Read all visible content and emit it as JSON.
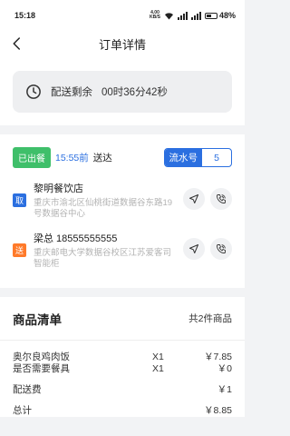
{
  "status_bar": {
    "time": "15:18",
    "net_speed_value": "4.00",
    "net_speed_unit": "KB/S",
    "battery": "48%"
  },
  "nav": {
    "title": "订单详情"
  },
  "countdown": {
    "label": "配送剩余",
    "value": "00时36分42秒"
  },
  "delivery": {
    "status_badge": "已出餐",
    "deadline_time": "15:55前",
    "deadline_suffix": "送达",
    "serial_label": "流水号",
    "serial_number": "5",
    "pickup": {
      "tag": "取",
      "name": "黎明餐饮店",
      "address": "重庆市渝北区仙桃街道数据谷东路19号数据谷中心"
    },
    "dropoff": {
      "tag": "送",
      "name": "梁总 18555555555",
      "address": "重庆邮电大学数据谷校区江苏爱客司智能柜"
    }
  },
  "goods": {
    "title": "商品清单",
    "count_text": "共2件商品",
    "items": [
      {
        "name": "奥尔良鸡肉饭",
        "qty": "X1",
        "price": "￥7.85"
      },
      {
        "name": "是否需要餐具",
        "qty": "X1",
        "price": "￥0"
      }
    ],
    "delivery_fee_label": "配送费",
    "delivery_fee_value": "￥1",
    "total_label": "总计",
    "total_value": "￥8.85"
  },
  "colors": {
    "accent_blue": "#2b6fe0",
    "badge_green": "#3fbf6a",
    "tag_orange": "#ff7a2a"
  }
}
